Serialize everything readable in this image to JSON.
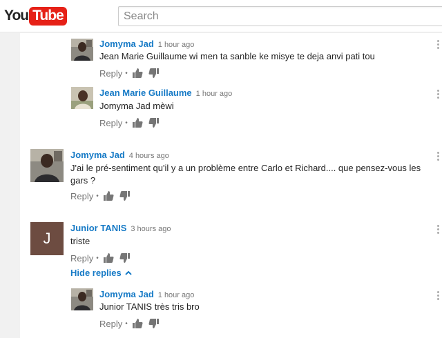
{
  "header": {
    "logo_you": "You",
    "logo_tube": "Tube",
    "search_placeholder": "Search"
  },
  "comments": [
    {
      "author": "Jomyma Jad",
      "time": "1 hour ago",
      "text": "Jean Marie Guillaume wi men ta sanble ke misye te deja anvi pati tou",
      "reply_label": "Reply"
    },
    {
      "author": "Jean Marie Guillaume",
      "time": "1 hour ago",
      "text": "Jomyma Jad mèwi",
      "reply_label": "Reply"
    },
    {
      "author": "Jomyma Jad",
      "time": "4 hours ago",
      "text": "J'ai le pré-sentiment qu'il y a un problème entre Carlo et Richard.... que pensez-vous les gars ?",
      "reply_label": "Reply"
    },
    {
      "author": "Junior TANIS",
      "time": "3 hours ago",
      "avatar_letter": "J",
      "text": "triste",
      "reply_label": "Reply"
    },
    {
      "author": "Jomyma Jad",
      "time": "1 hour ago",
      "text": "Junior TANIS très tris bro",
      "reply_label": "Reply"
    }
  ],
  "hide_replies_label": "Hide replies",
  "colors": {
    "brand_red": "#e62117",
    "author_blue": "#167ac6",
    "letter_avatar_bg": "#6d4c41"
  }
}
